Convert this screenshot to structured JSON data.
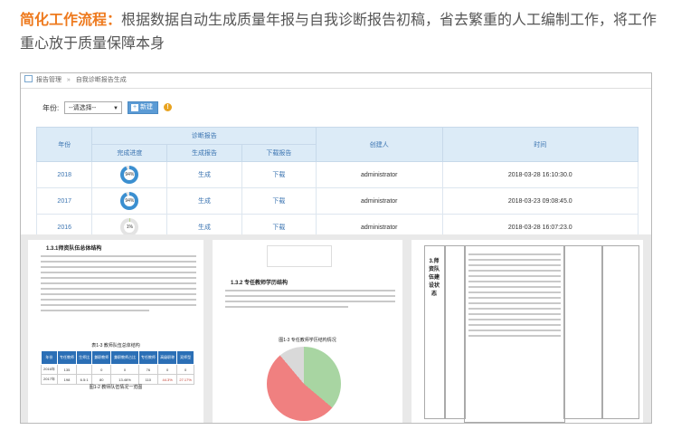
{
  "headline": {
    "title": "简化工作流程：",
    "text": "根据数据自动生成质量年报与自我诊断报告初稿，省去繁重的人工编制工作，将工作重心放于质量保障本身"
  },
  "breadcrumb": {
    "root": "报告管理",
    "separator": "»",
    "current": "自我诊断报告生成"
  },
  "toolbar": {
    "year_label": "年份:",
    "select_value": "--请选择--",
    "new_button": "新建",
    "icons": [
      "home-icon",
      "plus-icon",
      "warning-icon"
    ]
  },
  "table": {
    "headers": {
      "year": "年份",
      "group": "诊断报告",
      "progress": "完成进度",
      "generate": "生成报告",
      "download": "下载报告",
      "creator": "创建人",
      "time": "时间"
    },
    "rows": [
      {
        "year": "2018",
        "progress": "94%",
        "progress_value": 0.94,
        "generate": "生成",
        "download": "下载",
        "creator": "administrator",
        "time": "2018-03-28 16:10:30.0",
        "ring_color": "#3b8fd0"
      },
      {
        "year": "2017",
        "progress": "94%",
        "progress_value": 0.94,
        "generate": "生成",
        "download": "下载",
        "creator": "administrator",
        "time": "2018-03-23 09:08:45.0",
        "ring_color": "#3b8fd0"
      },
      {
        "year": "2016",
        "progress": "1%",
        "progress_value": 0.01,
        "generate": "生成",
        "download": "下载",
        "creator": "administrator",
        "time": "2018-03-28 16:07:23.0",
        "ring_color": "#8cc63f"
      }
    ]
  },
  "docs": {
    "page1": {
      "heading": "1.3.1师资队伍总体结构",
      "table_caption": "表1-3 教师队伍总体结构",
      "figure_caption": "图1-2 教师队伍情况一览图",
      "mini_headers": [
        "年份",
        "专任教师",
        "生师比",
        "兼职教师",
        "兼职教师占比",
        "专任教师",
        "高级职称",
        "双师型"
      ],
      "mini_rows": [
        [
          "2016年",
          "135",
          "",
          "0",
          "0",
          "76",
          "0",
          "0"
        ],
        [
          "2017年",
          "198",
          "6.5:1",
          "80",
          "13.46%",
          "110",
          "44.3%",
          "27.17%"
        ]
      ]
    },
    "page2": {
      "heading": "1.3.2 专任教师学历结构",
      "figure_caption": "图1-3 专任教师学历结构情况"
    },
    "page3": {
      "vertical_title": "3.师资队伍建设状态"
    }
  }
}
